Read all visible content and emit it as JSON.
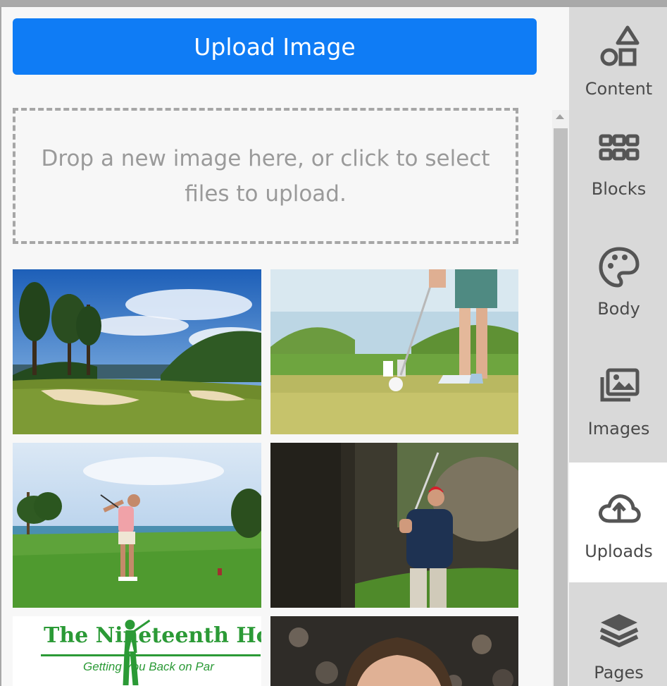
{
  "upload": {
    "button_label": "Upload Image",
    "dropzone_text": "Drop a new image here, or click to select files to upload."
  },
  "thumbnails": [
    {
      "icon": "golf-course-photo"
    },
    {
      "icon": "golfer-putting-photo"
    },
    {
      "icon": "woman-golfer-swing-photo"
    },
    {
      "icon": "man-red-hat-golfer-photo"
    },
    {
      "icon": "nineteenth-hole-logo",
      "logo_title": "The Nineteenth Hole",
      "logo_subtitle": "Getting You Back on Par"
    },
    {
      "icon": "man-portrait-photo"
    }
  ],
  "sidebar": {
    "tabs": [
      {
        "label": "Content",
        "icon": "shapes-icon"
      },
      {
        "label": "Blocks",
        "icon": "grid-icon"
      },
      {
        "label": "Body",
        "icon": "palette-icon"
      },
      {
        "label": "Images",
        "icon": "image-icon"
      },
      {
        "label": "Uploads",
        "icon": "cloud-upload-icon",
        "active": true
      },
      {
        "label": "Pages",
        "icon": "layers-icon"
      }
    ]
  },
  "colors": {
    "accent": "#0f7cf5",
    "logo_green": "#2b9a36",
    "sidebar_bg": "#d9d9d9"
  }
}
